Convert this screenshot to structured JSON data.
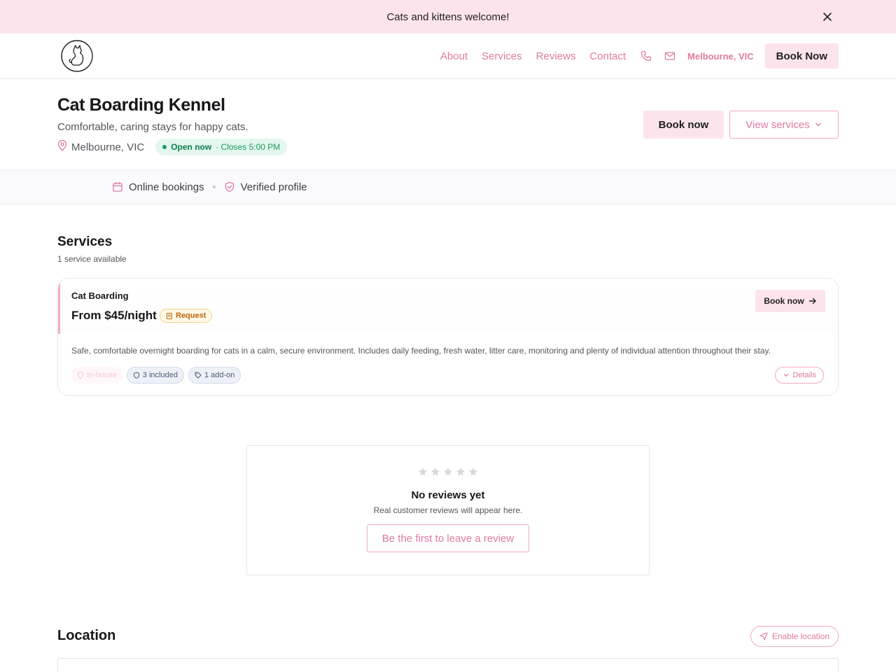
{
  "announcement": {
    "text": "Cats and kittens welcome!",
    "close_icon": "close-icon"
  },
  "nav": {
    "links": [
      "About",
      "Services",
      "Reviews",
      "Contact"
    ],
    "location": "Melbourne, VIC",
    "book_label": "Book Now",
    "icons": [
      "cat-logo",
      "phone-icon",
      "mail-icon"
    ]
  },
  "hero": {
    "title": "Cat Boarding Kennel",
    "tagline": "Comfortable, caring stays for happy cats.",
    "location": "Melbourne, VIC",
    "status": "Open now",
    "closes": "· Closes 5:00 PM",
    "primary_button": "Book now",
    "secondary_button": "View services"
  },
  "features": [
    {
      "label": "Online bookings",
      "icon": "calendar-icon"
    },
    {
      "label": "Verified profile",
      "icon": "shield-check-icon"
    }
  ],
  "services": {
    "title": "Services",
    "count_label": "1 service available",
    "items": [
      {
        "name": "Cat Boarding",
        "price": "From $45/night",
        "badge": "Request",
        "book_label": "Book now",
        "description": "Safe, comfortable overnight boarding for cats in a calm, secure environment. Includes daily feeding, fresh water, litter care, monitoring and plenty of individual attention throughout their stay.",
        "tags": [
          "In-house",
          "3 included",
          "1 add-on"
        ],
        "details_label": "Details"
      }
    ]
  },
  "reviews": {
    "rating": 0,
    "max_rating": 5,
    "title": "No reviews yet",
    "subtitle": "Real customer reviews will appear here.",
    "button": "Be the first to leave a review"
  },
  "location": {
    "title": "Location",
    "enable_button": "Enable location"
  },
  "colors": {
    "accent_pink": "#e07aa2",
    "soft_pink": "#fde4ec",
    "open_green": "#1aa364",
    "request_amber": "#b8660c"
  }
}
